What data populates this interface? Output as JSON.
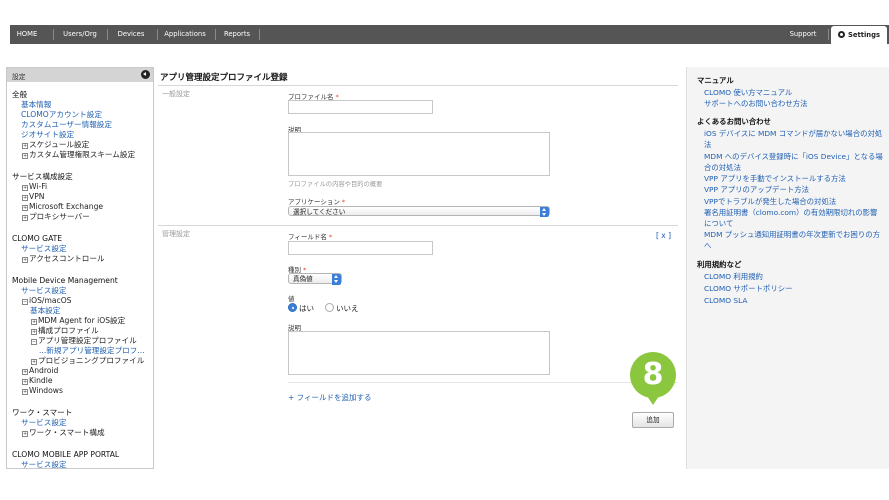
{
  "nav": {
    "items": [
      "HOME",
      "Users/Org",
      "Devices",
      "Applications",
      "Reports"
    ],
    "support": "Support",
    "settings": "Settings"
  },
  "sidebar": {
    "title": "設定",
    "groups": [
      {
        "heading": "全般",
        "items": [
          {
            "label": "基本情報",
            "type": "link"
          },
          {
            "label": "CLOMOアカウント設定",
            "type": "link"
          },
          {
            "label": "カスタムユーザー情報設定",
            "type": "link"
          },
          {
            "label": "ジオサイト設定",
            "type": "link"
          },
          {
            "label": "スケジュール設定",
            "type": "expand"
          },
          {
            "label": "カスタム管理権限スキーム設定",
            "type": "expand"
          }
        ]
      },
      {
        "heading": "サービス構成設定",
        "items": [
          {
            "label": "Wi-Fi",
            "type": "expand"
          },
          {
            "label": "VPN",
            "type": "expand"
          },
          {
            "label": "Microsoft Exchange",
            "type": "expand"
          },
          {
            "label": "プロキシサーバー",
            "type": "expand"
          }
        ]
      },
      {
        "heading": "CLOMO GATE",
        "items": [
          {
            "label": "サービス設定",
            "type": "link"
          },
          {
            "label": "アクセスコントロール",
            "type": "expand"
          }
        ]
      },
      {
        "heading": "Mobile Device Management",
        "items": [
          {
            "label": "サービス設定",
            "type": "link"
          },
          {
            "label": "iOS/macOS",
            "type": "collapse"
          },
          {
            "label": "基本設定",
            "type": "link"
          },
          {
            "label": "MDM Agent for iOS設定",
            "type": "expand"
          },
          {
            "label": "構成プロファイル",
            "type": "expand"
          },
          {
            "label": "アプリ管理設定プロファイル",
            "type": "collapse"
          },
          {
            "label": "...新規アプリ管理設定プロフ...",
            "type": "link"
          },
          {
            "label": "プロビジョニングプロファイル",
            "type": "expand"
          },
          {
            "label": "Android",
            "type": "expand"
          },
          {
            "label": "Kindle",
            "type": "expand"
          },
          {
            "label": "Windows",
            "type": "expand"
          }
        ]
      },
      {
        "heading": "ワーク・スマート",
        "items": [
          {
            "label": "サービス設定",
            "type": "link"
          },
          {
            "label": "ワーク・スマート構成",
            "type": "expand"
          }
        ]
      },
      {
        "heading": "CLOMO MOBILE APP PORTAL",
        "items": [
          {
            "label": "サービス設定",
            "type": "link"
          }
        ]
      }
    ]
  },
  "main": {
    "title": "アプリ管理設定プロファイル登録",
    "general_section": "一般設定",
    "profile_name_label": "プロファイル名",
    "description_label": "説明",
    "description_hint": "プロファイルの内容や目的の概要",
    "application_label": "アプリケーション",
    "application_value": "選択してください",
    "management_section": "管理設定",
    "field_name_label": "フィールド名",
    "remove_field": "[ x ]",
    "type_label": "種別",
    "type_value": "真偽値",
    "value_label": "値",
    "yes_label": "はい",
    "no_label": "いいえ",
    "yes_selected": true,
    "field_description_label": "説明",
    "add_field_link": "+ フィールドを追加する",
    "add_button": "追加",
    "step_number": "8",
    "required_mark": "*"
  },
  "rightbar": {
    "manual_heading": "マニュアル",
    "manual_links": [
      "CLOMO 使い方マニュアル",
      "サポートへのお問い合わせ方法"
    ],
    "faq_heading": "よくあるお問い合わせ",
    "faq_links": [
      "iOS デバイスに MDM コマンドが届かない場合の対処法",
      "MDM へのデバイス登録時に「iOS Device」となる場合の対処法",
      "VPP アプリを手動でインストールする方法",
      "VPP アプリのアップデート方法",
      "VPPでトラブルが発生した場合の対処法",
      "署名用証明書（clomo.com）の有効期限切れの影響について",
      "MDM プッシュ通知用証明書の年次更新でお困りの方へ"
    ],
    "terms_heading": "利用規約など",
    "terms_links": [
      "CLOMO 利用規約",
      "CLOMO サポートポリシー",
      "CLOMO SLA"
    ]
  },
  "colors": {
    "nav_bg": "#555555",
    "link": "#1f5fb3",
    "required": "#e0402a",
    "badge": "#8bc63f",
    "select_accent": "#3b7fd9"
  }
}
